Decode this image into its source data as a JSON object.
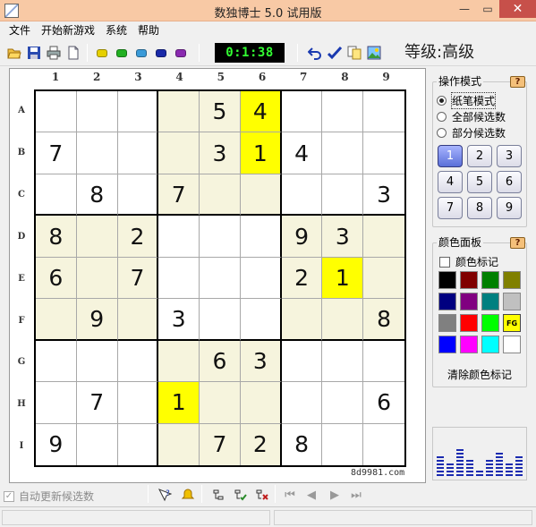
{
  "window": {
    "title": "数独博士 5.0 试用版",
    "minimize": "—",
    "maximize": "▭",
    "close": "✕"
  },
  "menu": [
    "文件",
    "开始新游戏",
    "系统",
    "帮助"
  ],
  "toolbar": {
    "icons": [
      "open-icon",
      "save-icon",
      "print-icon",
      "new-page-icon"
    ],
    "pill_colors": [
      "#e6d000",
      "#22b022",
      "#3a9ad8",
      "#1a2aa8",
      "#8a2ab0"
    ],
    "timer": "0:1:38",
    "action_icons": [
      "undo-icon",
      "check-icon",
      "copy-icon",
      "image-icon"
    ],
    "level": "等级:高级"
  },
  "board": {
    "col_labels": [
      "1",
      "2",
      "3",
      "4",
      "5",
      "6",
      "7",
      "8",
      "9"
    ],
    "row_labels": [
      "A",
      "B",
      "C",
      "D",
      "E",
      "F",
      "G",
      "H",
      "I"
    ],
    "cells": [
      [
        "",
        "",
        "",
        "",
        "5",
        "4",
        "",
        "",
        ""
      ],
      [
        "7",
        "",
        "",
        "",
        "3",
        "1",
        "4",
        "",
        ""
      ],
      [
        "",
        "8",
        "",
        "7",
        "",
        "",
        "",
        "",
        "3"
      ],
      [
        "8",
        "",
        "2",
        "",
        "",
        "",
        "9",
        "3",
        ""
      ],
      [
        "6",
        "",
        "7",
        "",
        "",
        "",
        "2",
        "1",
        ""
      ],
      [
        "",
        "9",
        "",
        "3",
        "",
        "",
        "",
        "",
        "8"
      ],
      [
        "",
        "",
        "",
        "",
        "6",
        "3",
        "",
        "",
        ""
      ],
      [
        "",
        "7",
        "",
        "1",
        "",
        "",
        "",
        "",
        "6"
      ],
      [
        "9",
        "",
        "",
        "",
        "7",
        "2",
        "8",
        "",
        ""
      ]
    ],
    "highlighted": [
      "A6-B6",
      "E8",
      "H4"
    ],
    "watermark": "8d9981.com"
  },
  "mode_panel": {
    "title": "操作模式",
    "help": "?",
    "options": [
      "纸笔模式",
      "全部候选数",
      "部分候选数"
    ],
    "selected": 0,
    "numbers": [
      "1",
      "2",
      "3",
      "4",
      "5",
      "6",
      "7",
      "8",
      "9"
    ],
    "active_number": "1"
  },
  "color_panel": {
    "title": "颜色面板",
    "help": "?",
    "checkbox_label": "颜色标记",
    "swatches": [
      "#000000",
      "#800000",
      "#008000",
      "#808000",
      "#000080",
      "#800080",
      "#008080",
      "#c0c0c0",
      "#808080",
      "#ff0000",
      "#00ff00",
      "#ffff00",
      "#0000ff",
      "#ff00ff",
      "#00ffff",
      "#ffffff"
    ],
    "fg_label": "FG",
    "clear_label": "清除颜色标记"
  },
  "bottom": {
    "auto_update_label": "自动更新候选数",
    "icons": [
      "hint-icon",
      "bell-icon",
      "tree-icon",
      "tree-check-icon",
      "tree-cross-icon",
      "first-icon",
      "prev-icon",
      "next-icon",
      "last-icon"
    ]
  }
}
